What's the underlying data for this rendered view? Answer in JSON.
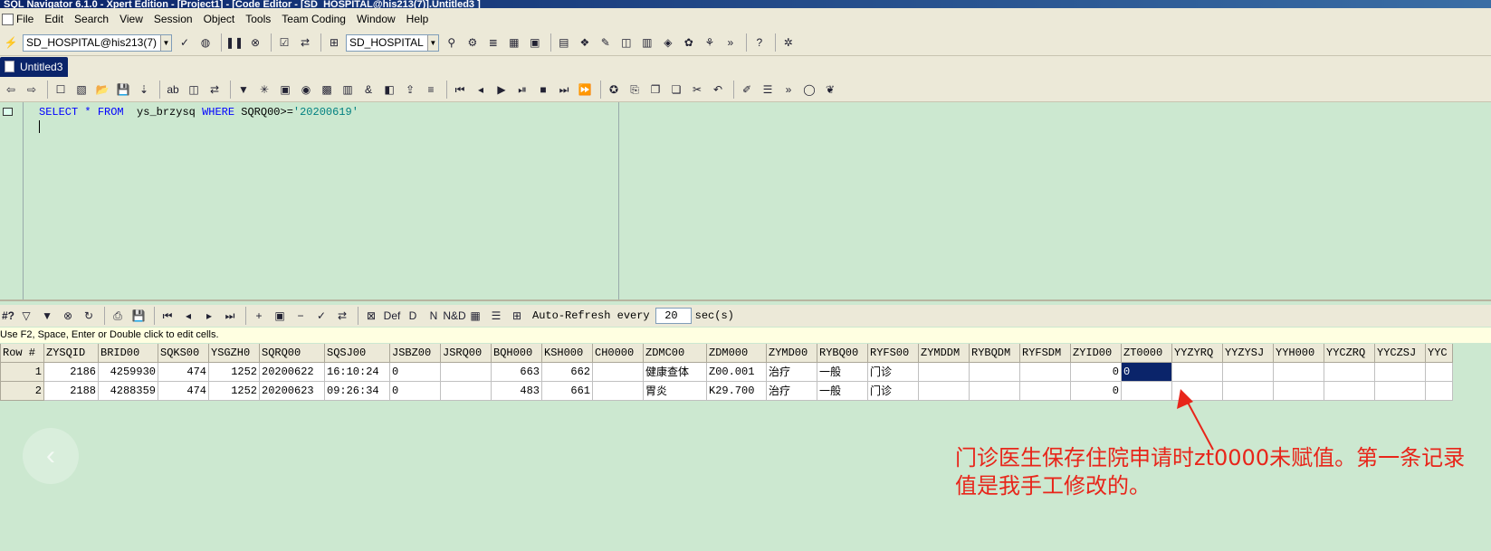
{
  "window": {
    "title": "SQL Navigator 6.1.0 - Xpert Edition - [Project1] - [Code Editor - [SD_HOSPITAL@his213(7)].Untitled3 ]"
  },
  "menu": [
    "File",
    "Edit",
    "Search",
    "View",
    "Session",
    "Object",
    "Tools",
    "Team Coding",
    "Window",
    "Help"
  ],
  "toolbar": {
    "session_combo": "SD_HOSPITAL@his213(7)",
    "schema_combo": "SD_HOSPITAL"
  },
  "tab": {
    "label": "Untitled3"
  },
  "editor": {
    "line1": {
      "kw1": "SELECT",
      "star": "*",
      "kw2": "FROM",
      "table": "ys_brzysq",
      "kw3": "WHERE",
      "col": "SQRQ00>=",
      "value": "'20200619'"
    }
  },
  "gridbar": {
    "prefix": "#?",
    "auto_refresh_label": "Auto-Refresh every",
    "interval": "20",
    "unit": "sec(s)"
  },
  "hint": "Use F2, Space, Enter or Double click to edit cells.",
  "grid": {
    "columns": [
      "Row #",
      "ZYSQID",
      "BRID00",
      "SQKS00",
      "YSGZH0",
      "SQRQ00",
      "SQSJ00",
      "JSBZ00",
      "JSRQ00",
      "BQH000",
      "KSH000",
      "CH0000",
      "ZDMC00",
      "ZDM000",
      "ZYMD00",
      "RYBQ00",
      "RYFS00",
      "ZYMDDM",
      "RYBQDM",
      "RYFSDM",
      "ZYID00",
      "ZT0000",
      "YYZYRQ",
      "YYZYSJ",
      "YYH000",
      "YYCZRQ",
      "YYCZSJ",
      "YYC"
    ],
    "rows": [
      [
        "1",
        "2186",
        "4259930",
        "474",
        "1252",
        "20200622",
        "16:10:24",
        "0",
        "",
        "663",
        "662",
        "",
        "健康查体",
        "Z00.001",
        "治疗",
        "一般",
        "门诊",
        "",
        "",
        "",
        "0",
        "0",
        "",
        "",
        "",
        "",
        "",
        ""
      ],
      [
        "2",
        "2188",
        "4288359",
        "474",
        "1252",
        "20200623",
        "09:26:34",
        "0",
        "",
        "483",
        "661",
        "",
        "胃炎",
        "K29.700",
        "治疗",
        "一般",
        "门诊",
        "",
        "",
        "",
        "0",
        "",
        "",
        "",
        "",
        "",
        "",
        ""
      ]
    ]
  },
  "annotation": {
    "line1": "门诊医生保存住院申请时zt0000未赋值。第一条记录",
    "line2": "值是我手工修改的。"
  }
}
